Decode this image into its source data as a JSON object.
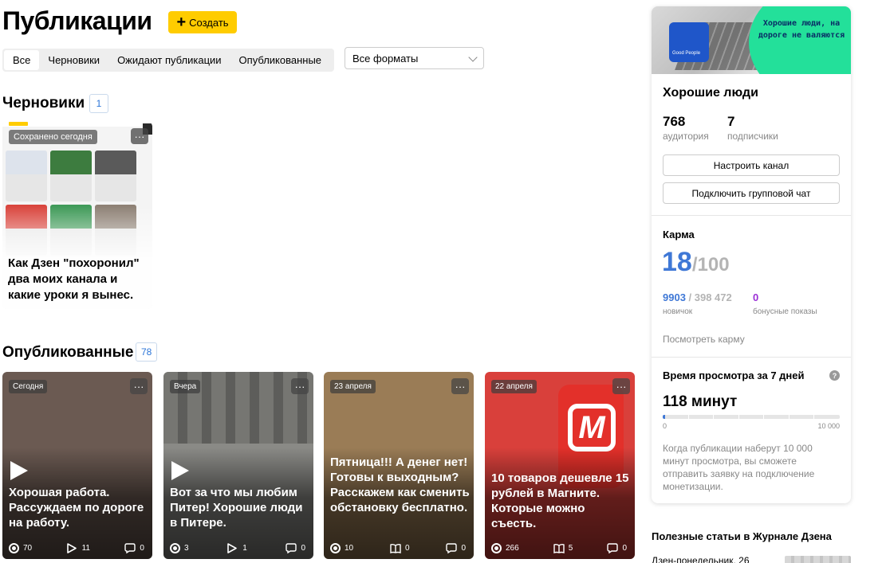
{
  "header": {
    "title": "Публикации",
    "create_label": "Создать"
  },
  "tabs": [
    {
      "label": "Все",
      "active": true
    },
    {
      "label": "Черновики",
      "active": false
    },
    {
      "label": "Ожидают публикации",
      "active": false
    },
    {
      "label": "Опубликованные",
      "active": false
    }
  ],
  "format_select": {
    "value": "Все форматы"
  },
  "drafts": {
    "title": "Черновики",
    "count": "1",
    "card": {
      "saved_label": "Сохранено сегодня",
      "title": "Как Дзен \"похоронил\" два моих канала и какие уроки я вынес.",
      "more": "···"
    }
  },
  "published": {
    "title": "Опубликованные",
    "count": "78",
    "cards": [
      {
        "date": "Сегодня",
        "title": "Хорошая работа. Рассуждаем по дороге на работу.",
        "views": "70",
        "second": "11",
        "second_icon": "play-icon",
        "comments": "0",
        "is_video": true,
        "bg": "#6b5a52"
      },
      {
        "date": "Вчера",
        "title": "Вот за что мы любим Питер! Хорошие люди в Питере.",
        "views": "3",
        "second": "1",
        "second_icon": "play-icon",
        "comments": "0",
        "is_video": true,
        "bg": "#8a8a86"
      },
      {
        "date": "23 апреля",
        "title": "Пятница!!! А денег нет! Готовы к выходным? Расскажем как сменить обстановку бесплатно.",
        "views": "10",
        "second": "0",
        "second_icon": "book-icon",
        "comments": "0",
        "is_video": false,
        "bg": "#9a7c56"
      },
      {
        "date": "22 апреля",
        "title": "10 товаров дешевле 15 рублей в Магните. Которые можно съесть.",
        "views": "266",
        "second": "5",
        "second_icon": "book-icon",
        "comments": "0",
        "is_video": false,
        "bg": "#d9403b"
      }
    ]
  },
  "channel": {
    "cover_text": "Хорошие люди, на дороге не валяются",
    "logo_text": "Good People",
    "name": "Хорошие люди",
    "audience_num": "768",
    "audience_lbl": "аудитория",
    "subs_num": "7",
    "subs_lbl": "подписчики",
    "setup_btn": "Настроить канал",
    "chat_btn": "Подключить групповой чат"
  },
  "karma": {
    "label": "Карма",
    "score": "18",
    "max": "/100",
    "rank": "9903",
    "rank_total": " / 398 472",
    "rank_lbl": "новичок",
    "bonus": "0",
    "bonus_lbl": "бонусные показы",
    "link": "Посмотреть карму"
  },
  "watch_time": {
    "title": "Время просмотра за 7 дней",
    "help": "?",
    "value": "118 минут",
    "progress_fraction": 0.0118,
    "axis_min": "0",
    "axis_max": "10 000",
    "note": "Когда публикации наберут 10 000 минут просмотра, вы сможете отправить заявку на подключение монетизации."
  },
  "useful": {
    "title": "Полезные статьи в Журнале Дзена",
    "first_item": "Дзен-понедельник. 26"
  },
  "colors": {
    "accent_yellow": "#ffcc00",
    "karma_blue": "#3f78d6",
    "bonus_purple": "#9b2fd6",
    "badge_blue": "#2b75d8"
  }
}
